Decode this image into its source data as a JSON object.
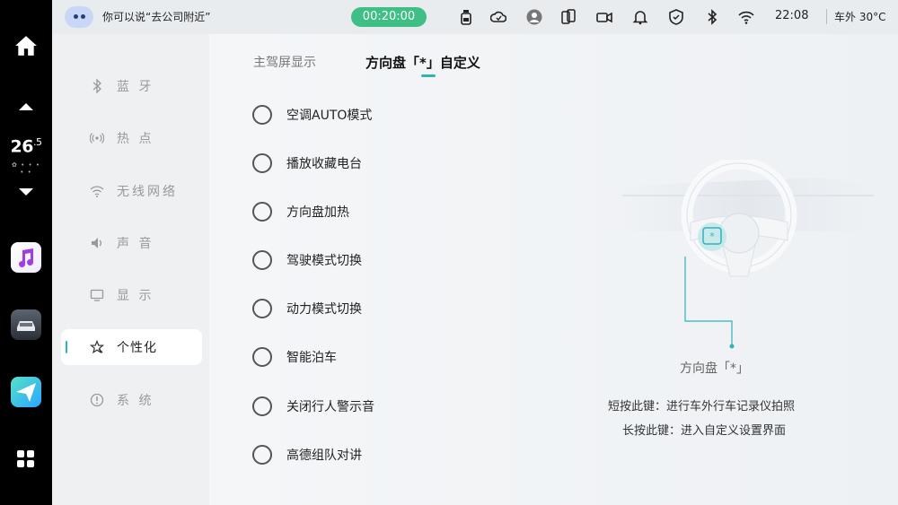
{
  "status_bar": {
    "assistant_hint": "你可以说“去公司附近”",
    "timer": "00:20:00",
    "clock": "22:08",
    "outside_temp": "车外 30°C"
  },
  "dock": {
    "temperature": "26.5",
    "temperature_main": "26",
    "temperature_decimal": ".5"
  },
  "menu": {
    "items": [
      {
        "label": "蓝 牙",
        "icon": "bluetooth-icon"
      },
      {
        "label": "热 点",
        "icon": "hotspot-icon"
      },
      {
        "label": "无线网络",
        "icon": "wifi-icon"
      },
      {
        "label": "声 音",
        "icon": "speaker-icon"
      },
      {
        "label": "显 示",
        "icon": "display-icon"
      },
      {
        "label": "个性化",
        "icon": "personalize-icon",
        "active": true
      },
      {
        "label": "系 统",
        "icon": "system-icon"
      }
    ]
  },
  "tabs": [
    {
      "label": "主驾屏显示"
    },
    {
      "label": "方向盘「*」自定义",
      "active": true
    }
  ],
  "options": [
    {
      "label": "空调AUTO模式"
    },
    {
      "label": "播放收藏电台"
    },
    {
      "label": "方向盘加热"
    },
    {
      "label": "驾驶模式切换"
    },
    {
      "label": "动力模式切换"
    },
    {
      "label": "智能泊车"
    },
    {
      "label": "关闭行人警示音"
    },
    {
      "label": "高德组队对讲"
    }
  ],
  "illustration": {
    "caption": "方向盘「*」",
    "short_press": "短按此键：进行车外行车记录仪拍照",
    "long_press": "长按此键：进入自定义设置界面"
  },
  "colors": {
    "accent": "#2eb3b8",
    "timer_bg": "#3fbf85"
  }
}
